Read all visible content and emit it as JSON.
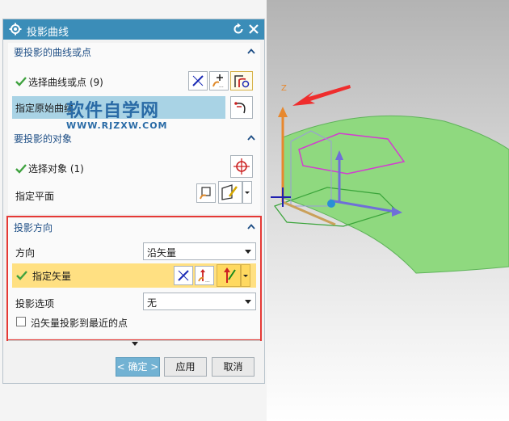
{
  "dialog": {
    "title": "投影曲线",
    "groups": {
      "curves": {
        "header": "要投影的曲线或点",
        "select_label": "选择曲线或点 (9)",
        "specify_origin_label": "指定原始曲线"
      },
      "objects": {
        "header": "要投影的对象",
        "select_label": "选择对象 (1)",
        "plane_label": "指定平面"
      },
      "direction": {
        "header": "投影方向",
        "direction_label": "方向",
        "direction_value": "沿矢量",
        "vector_label": "指定矢量",
        "option_label": "投影选项",
        "option_value": "无",
        "nearest_point_label": "沿矢量投影到最近的点",
        "nearest_point_checked": false
      }
    },
    "buttons": {
      "ok": "< 确定 >",
      "apply": "应用",
      "cancel": "取消"
    }
  },
  "watermark": {
    "title": "软件自学网",
    "url": "WWW.RJZXW.COM"
  },
  "viewport": {
    "axis_label_z": "Z"
  },
  "colors": {
    "titlebar": "#3b8db8",
    "header_text": "#1f4f86",
    "highlight_row": "#ffe082",
    "selection_field": "#a9d3e5",
    "frame_red": "#e53935",
    "surface_green": "#8fd97f",
    "check_green": "#3fa23f"
  }
}
